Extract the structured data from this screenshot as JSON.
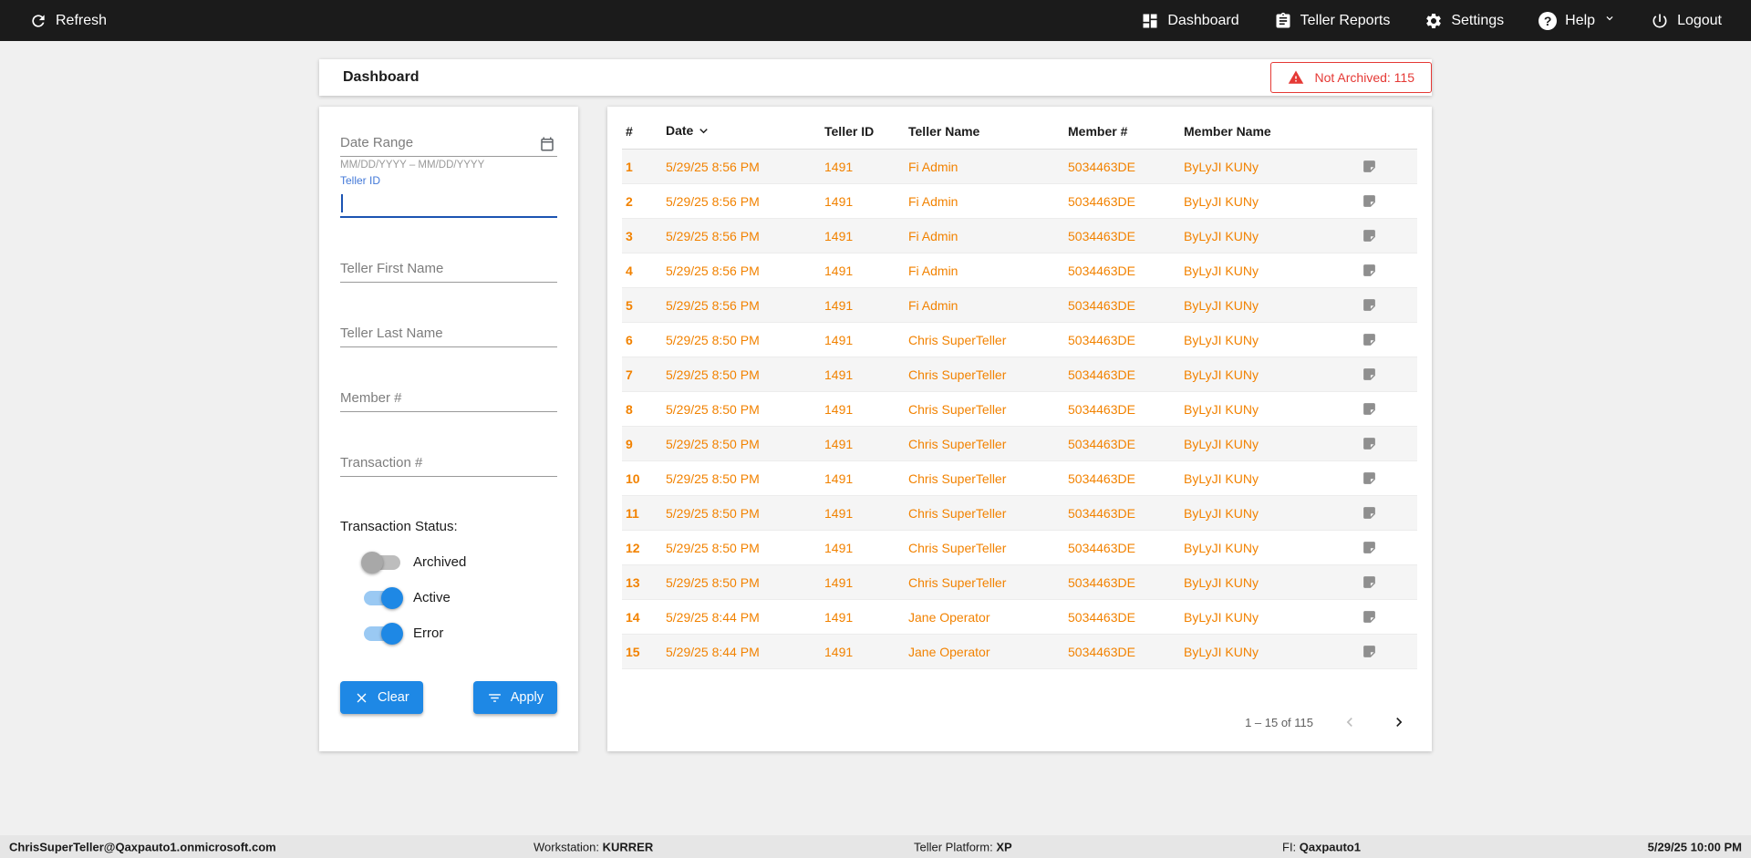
{
  "colors": {
    "topbar": "#1b1b1b",
    "accent_blue": "#1e88e5",
    "row_orange": "#f28200",
    "alert_red": "#e53935",
    "page_bg": "#f0f0f0"
  },
  "topbar": {
    "refresh": "Refresh",
    "nav": [
      {
        "label": "Dashboard",
        "icon": "dashboard-grid-icon"
      },
      {
        "label": "Teller Reports",
        "icon": "clipboard-icon"
      },
      {
        "label": "Settings",
        "icon": "gear-icon"
      },
      {
        "label": "Help",
        "icon": "help-circle-icon"
      },
      {
        "label": "Logout",
        "icon": "power-icon"
      }
    ]
  },
  "header": {
    "title": "Dashboard",
    "badge": "Not Archived: 115"
  },
  "filters": {
    "date_range_placeholder": "Date Range",
    "date_format_hint": "MM/DD/YYYY – MM/DD/YYYY",
    "teller_id_label": "Teller ID",
    "teller_id_value": "",
    "teller_first_name_placeholder": "Teller First Name",
    "teller_last_name_placeholder": "Teller Last Name",
    "member_number_placeholder": "Member #",
    "transaction_number_placeholder": "Transaction #",
    "status_label": "Transaction Status:",
    "toggles": [
      {
        "label": "Archived",
        "on": false
      },
      {
        "label": "Active",
        "on": true
      },
      {
        "label": "Error",
        "on": true
      }
    ],
    "clear_label": "Clear",
    "apply_label": "Apply"
  },
  "table": {
    "columns": [
      "#",
      "Date",
      "Teller ID",
      "Teller Name",
      "Member #",
      "Member Name"
    ],
    "sorted_column": "Date",
    "rows": [
      {
        "num": "1",
        "date": "5/29/25 8:56 PM",
        "teller_id": "1491",
        "teller_name": "Fi Admin",
        "member_num": "5034463DE",
        "member_name": "ByLyJI KUNy"
      },
      {
        "num": "2",
        "date": "5/29/25 8:56 PM",
        "teller_id": "1491",
        "teller_name": "Fi Admin",
        "member_num": "5034463DE",
        "member_name": "ByLyJI KUNy"
      },
      {
        "num": "3",
        "date": "5/29/25 8:56 PM",
        "teller_id": "1491",
        "teller_name": "Fi Admin",
        "member_num": "5034463DE",
        "member_name": "ByLyJI KUNy"
      },
      {
        "num": "4",
        "date": "5/29/25 8:56 PM",
        "teller_id": "1491",
        "teller_name": "Fi Admin",
        "member_num": "5034463DE",
        "member_name": "ByLyJI KUNy"
      },
      {
        "num": "5",
        "date": "5/29/25 8:56 PM",
        "teller_id": "1491",
        "teller_name": "Fi Admin",
        "member_num": "5034463DE",
        "member_name": "ByLyJI KUNy"
      },
      {
        "num": "6",
        "date": "5/29/25 8:50 PM",
        "teller_id": "1491",
        "teller_name": "Chris SuperTeller",
        "member_num": "5034463DE",
        "member_name": "ByLyJI KUNy"
      },
      {
        "num": "7",
        "date": "5/29/25 8:50 PM",
        "teller_id": "1491",
        "teller_name": "Chris SuperTeller",
        "member_num": "5034463DE",
        "member_name": "ByLyJI KUNy"
      },
      {
        "num": "8",
        "date": "5/29/25 8:50 PM",
        "teller_id": "1491",
        "teller_name": "Chris SuperTeller",
        "member_num": "5034463DE",
        "member_name": "ByLyJI KUNy"
      },
      {
        "num": "9",
        "date": "5/29/25 8:50 PM",
        "teller_id": "1491",
        "teller_name": "Chris SuperTeller",
        "member_num": "5034463DE",
        "member_name": "ByLyJI KUNy"
      },
      {
        "num": "10",
        "date": "5/29/25 8:50 PM",
        "teller_id": "1491",
        "teller_name": "Chris SuperTeller",
        "member_num": "5034463DE",
        "member_name": "ByLyJI KUNy"
      },
      {
        "num": "11",
        "date": "5/29/25 8:50 PM",
        "teller_id": "1491",
        "teller_name": "Chris SuperTeller",
        "member_num": "5034463DE",
        "member_name": "ByLyJI KUNy"
      },
      {
        "num": "12",
        "date": "5/29/25 8:50 PM",
        "teller_id": "1491",
        "teller_name": "Chris SuperTeller",
        "member_num": "5034463DE",
        "member_name": "ByLyJI KUNy"
      },
      {
        "num": "13",
        "date": "5/29/25 8:50 PM",
        "teller_id": "1491",
        "teller_name": "Chris SuperTeller",
        "member_num": "5034463DE",
        "member_name": "ByLyJI KUNy"
      },
      {
        "num": "14",
        "date": "5/29/25 8:44 PM",
        "teller_id": "1491",
        "teller_name": "Jane Operator",
        "member_num": "5034463DE",
        "member_name": "ByLyJI KUNy"
      },
      {
        "num": "15",
        "date": "5/29/25 8:44 PM",
        "teller_id": "1491",
        "teller_name": "Jane Operator",
        "member_num": "5034463DE",
        "member_name": "ByLyJI KUNy"
      }
    ],
    "row_icon": "note-icon",
    "pagination": {
      "range": "1 – 15 of 115",
      "prev_enabled": false,
      "next_enabled": true
    }
  },
  "footer": {
    "user": "ChrisSuperTeller@Qaxpauto1.onmicrosoft.com",
    "workstation_label": "Workstation: ",
    "workstation_value": "KURRER",
    "platform_label": "Teller Platform: ",
    "platform_value": "XP",
    "fi_label": "FI: ",
    "fi_value": "Qaxpauto1",
    "datetime": "5/29/25 10:00 PM"
  }
}
